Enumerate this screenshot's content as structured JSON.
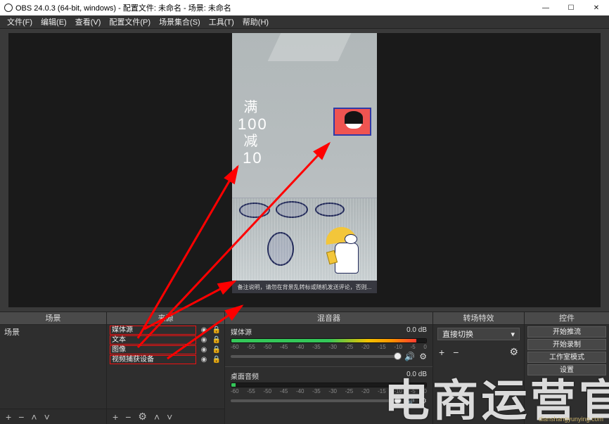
{
  "window": {
    "title": "OBS 24.0.3 (64-bit, windows) - 配置文件: 未命名 - 场景: 未命名"
  },
  "menubar": {
    "items": [
      {
        "label": "文件(F)"
      },
      {
        "label": "编辑(E)"
      },
      {
        "label": "查看(V)"
      },
      {
        "label": "配置文件(P)"
      },
      {
        "label": "场景集合(S)"
      },
      {
        "label": "工具(T)"
      },
      {
        "label": "帮助(H)"
      }
    ]
  },
  "preview": {
    "text_overlay": {
      "l1": "满",
      "l2": "100",
      "l3": "减",
      "l4": "10"
    },
    "caption": "备注说明，请勿在背景乱转标或随机发送评论，否则..."
  },
  "panels": {
    "scenes": {
      "title": "场景",
      "items": [
        {
          "name": "场景"
        }
      ]
    },
    "sources": {
      "title": "来源",
      "items": [
        {
          "name": "媒体源",
          "boxed": true
        },
        {
          "name": "文本",
          "boxed": true
        },
        {
          "name": "图像",
          "boxed": true
        },
        {
          "name": "视频捕获设备",
          "boxed": true
        }
      ]
    },
    "mixer": {
      "title": "混音器",
      "ticks": [
        "-60",
        "-55",
        "-50",
        "-45",
        "-40",
        "-35",
        "-30",
        "-25",
        "-20",
        "-15",
        "-10",
        "-5",
        "0"
      ],
      "items": [
        {
          "name": "媒体源",
          "db": "0.0 dB",
          "fill_dark_pct": 5,
          "knob_pct": 96
        },
        {
          "name": "桌面音频",
          "db": "0.0 dB",
          "fill_dark_pct": 98,
          "knob_pct": 96
        }
      ]
    },
    "transitions": {
      "title": "转场特效",
      "selected": "直接切换"
    },
    "controls": {
      "title": "控件",
      "buttons": [
        {
          "label": "开始推流"
        },
        {
          "label": "开始录制"
        },
        {
          "label": "工作室模式"
        },
        {
          "label": "设置"
        }
      ]
    }
  },
  "watermark": {
    "text": "电商运营官",
    "url": "dianshangyunying.com"
  }
}
